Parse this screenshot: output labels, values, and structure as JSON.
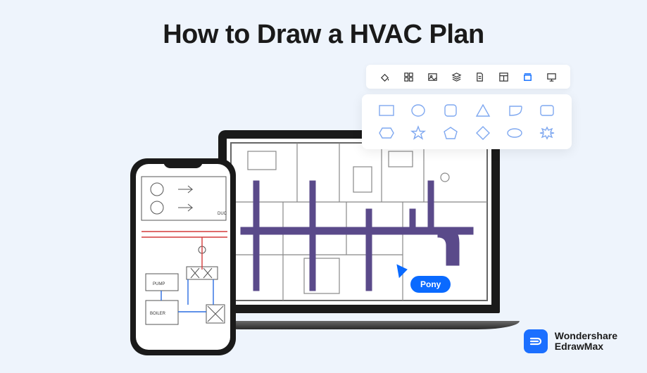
{
  "title": "How to Draw a HVAC Plan",
  "cursor": {
    "label": "Pony"
  },
  "logo": {
    "line1": "Wondershare",
    "line2": "EdrawMax"
  },
  "phone": {
    "labels": {
      "pump": "PUMP",
      "boiler": "BOILER",
      "duct": "DUC"
    }
  },
  "toolbar": {
    "icons": [
      {
        "name": "fill-icon"
      },
      {
        "name": "grid-icon"
      },
      {
        "name": "image-icon"
      },
      {
        "name": "layers-icon"
      },
      {
        "name": "page-icon"
      },
      {
        "name": "layout-icon"
      },
      {
        "name": "container-icon",
        "active": true
      },
      {
        "name": "presentation-icon"
      }
    ]
  },
  "shapes": {
    "row1": [
      "rectangle",
      "circle",
      "rounded-square",
      "triangle",
      "parallelogram",
      "rounded-rect"
    ],
    "row2": [
      "hexagon",
      "star",
      "pentagon",
      "diamond",
      "ellipse",
      "burst"
    ]
  },
  "colors": {
    "accent": "#0a6aff",
    "shape_stroke": "#7fa8f0",
    "duct": "#5a4a8a"
  }
}
